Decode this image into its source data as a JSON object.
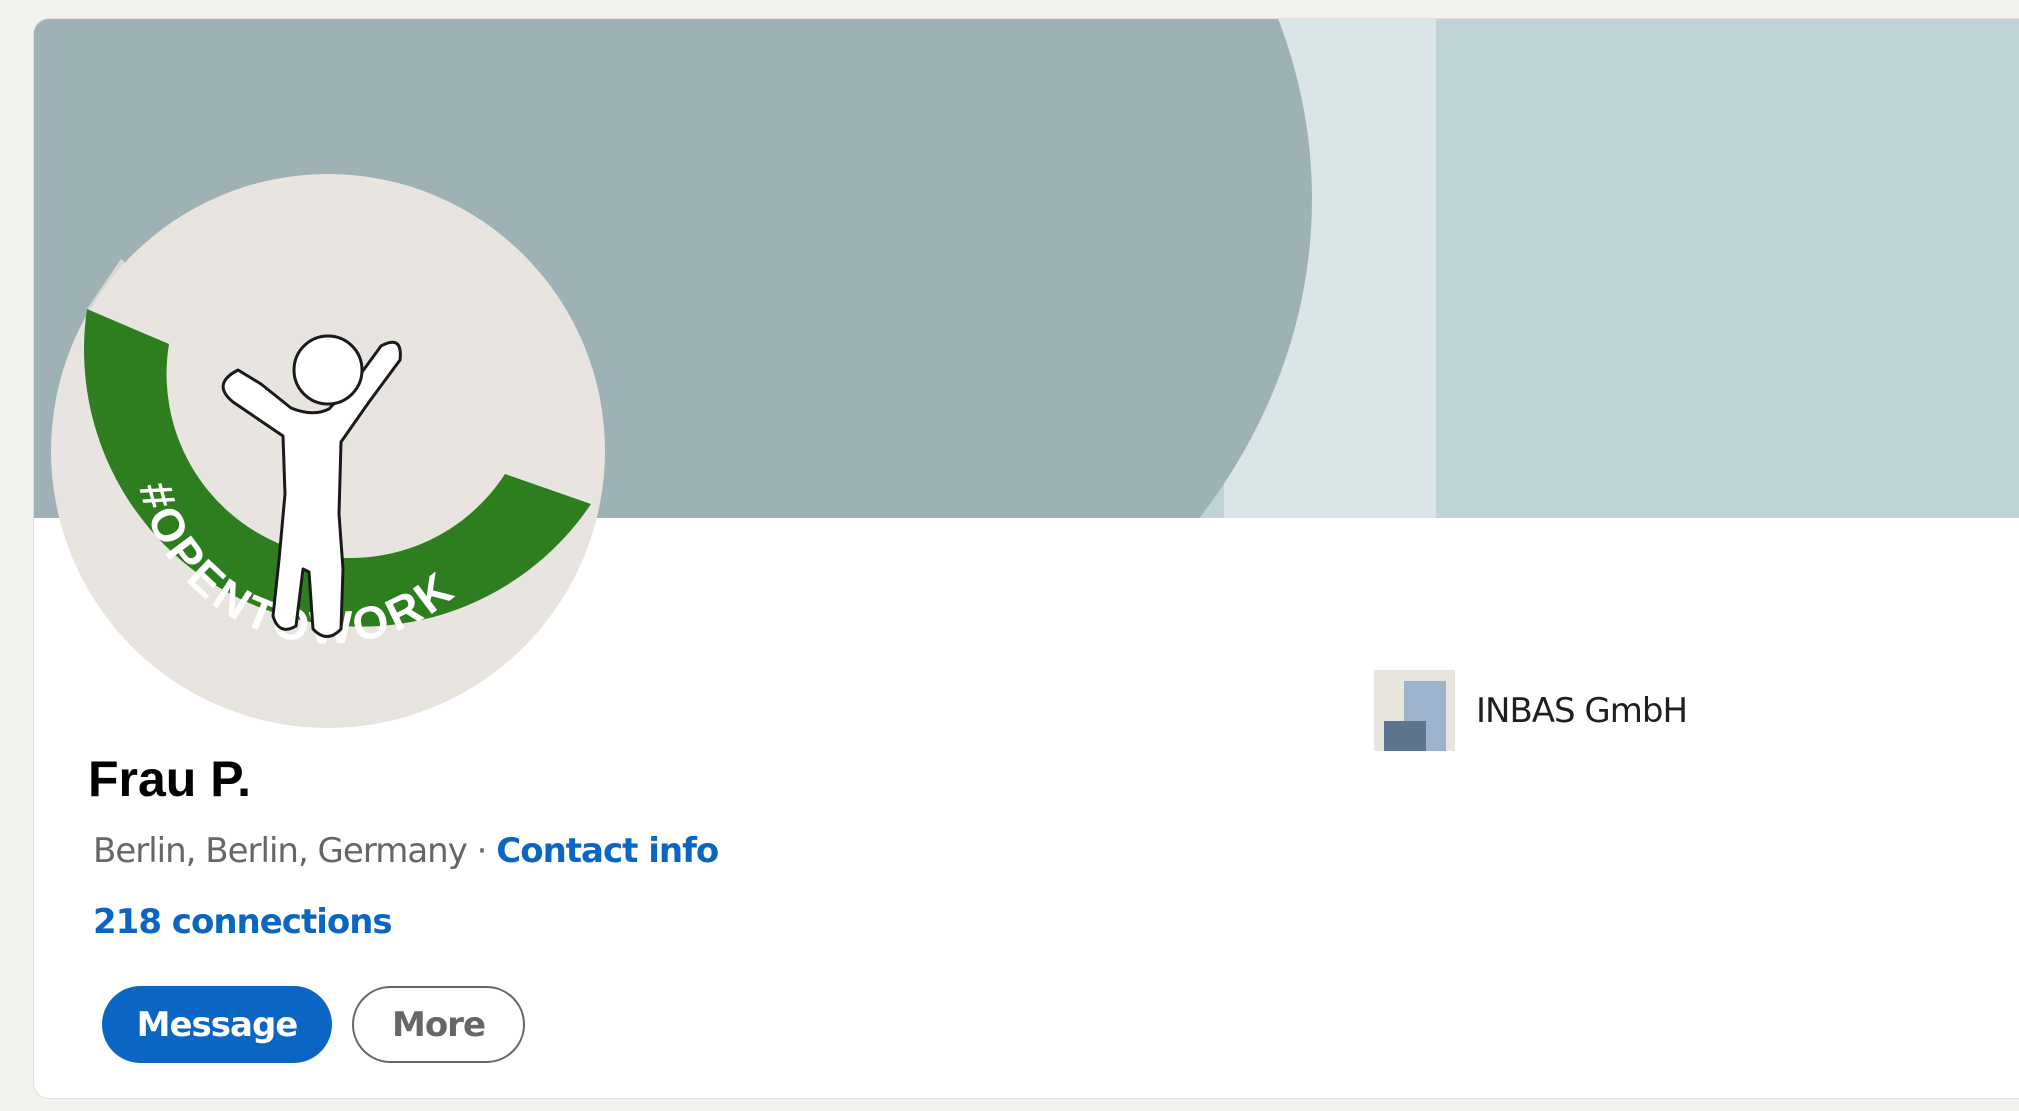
{
  "profile": {
    "name": "Frau P.",
    "location": "Berlin, Berlin, Germany",
    "separator": "·",
    "contact_info": "Contact info",
    "connections": "218 connections",
    "badge_text": "#OPENTOWORK"
  },
  "actions": {
    "message_label": "Message",
    "more_label": "More"
  },
  "company": {
    "name": "INBAS GmbH"
  },
  "colors": {
    "brand_blue": "#0a66c2",
    "open_to_work_green": "#2e7d1f",
    "banner_light": "#bfd2d5",
    "banner_dark": "#9eb2b5"
  },
  "icons": {
    "avatar": "person-placeholder-icon",
    "company_logo": "company-logo-icon"
  }
}
